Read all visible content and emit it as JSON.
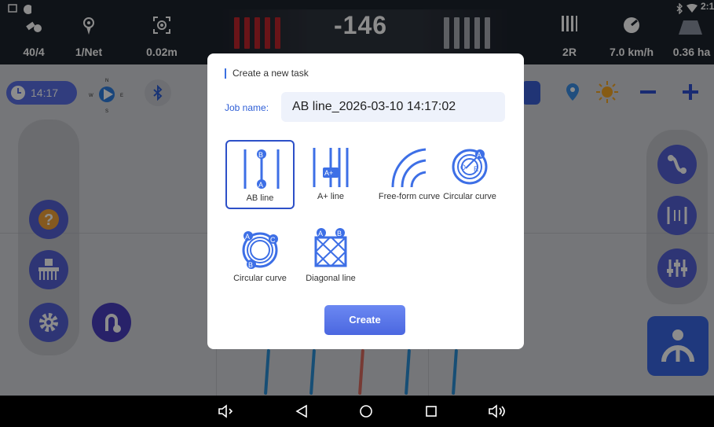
{
  "status": {
    "satellites": "40/4",
    "network": "1/Net",
    "precision": "0.02m",
    "clock": "2:1",
    "lateral_offset": "-146",
    "rows": "2R",
    "speed": "7.0 km/h",
    "area": "0.36 ha"
  },
  "left_panel": {
    "time": "14:17"
  },
  "compass": {
    "n": "N",
    "s": "S",
    "e": "E",
    "w": "W"
  },
  "dialog": {
    "title": "Create a new task",
    "job_name_label": "Job name:",
    "job_name_value": "AB line_2026-03-10 14:17:02",
    "options": [
      {
        "label": "AB line",
        "selected": true
      },
      {
        "label": "A+ line",
        "selected": false
      },
      {
        "label": "Free-form curve",
        "selected": false
      },
      {
        "label": "Circular curve",
        "selected": false
      },
      {
        "label": "Circular curve",
        "selected": false
      },
      {
        "label": "Diagonal line",
        "selected": false
      }
    ],
    "create_label": "Create"
  },
  "colors": {
    "accent": "#4b67e0",
    "selected_border": "#2d50c8",
    "offset_bars": "#c0252d",
    "topbar": "#1d232d"
  },
  "icons": [
    "satellite-icon",
    "antenna-icon",
    "precision-target-icon",
    "rows-icon",
    "speedometer-icon",
    "bluetooth-icon",
    "wifi-icon",
    "clock-icon",
    "compass-icon",
    "help-icon",
    "implement-icon",
    "settings-icon",
    "u-turn-icon",
    "zoom-out-icon",
    "zoom-in-icon",
    "brightness-icon",
    "location-pin-icon",
    "ab-curve-icon",
    "parallel-lines-icon",
    "adjust-sliders-icon",
    "steering-wheel-icon"
  ]
}
